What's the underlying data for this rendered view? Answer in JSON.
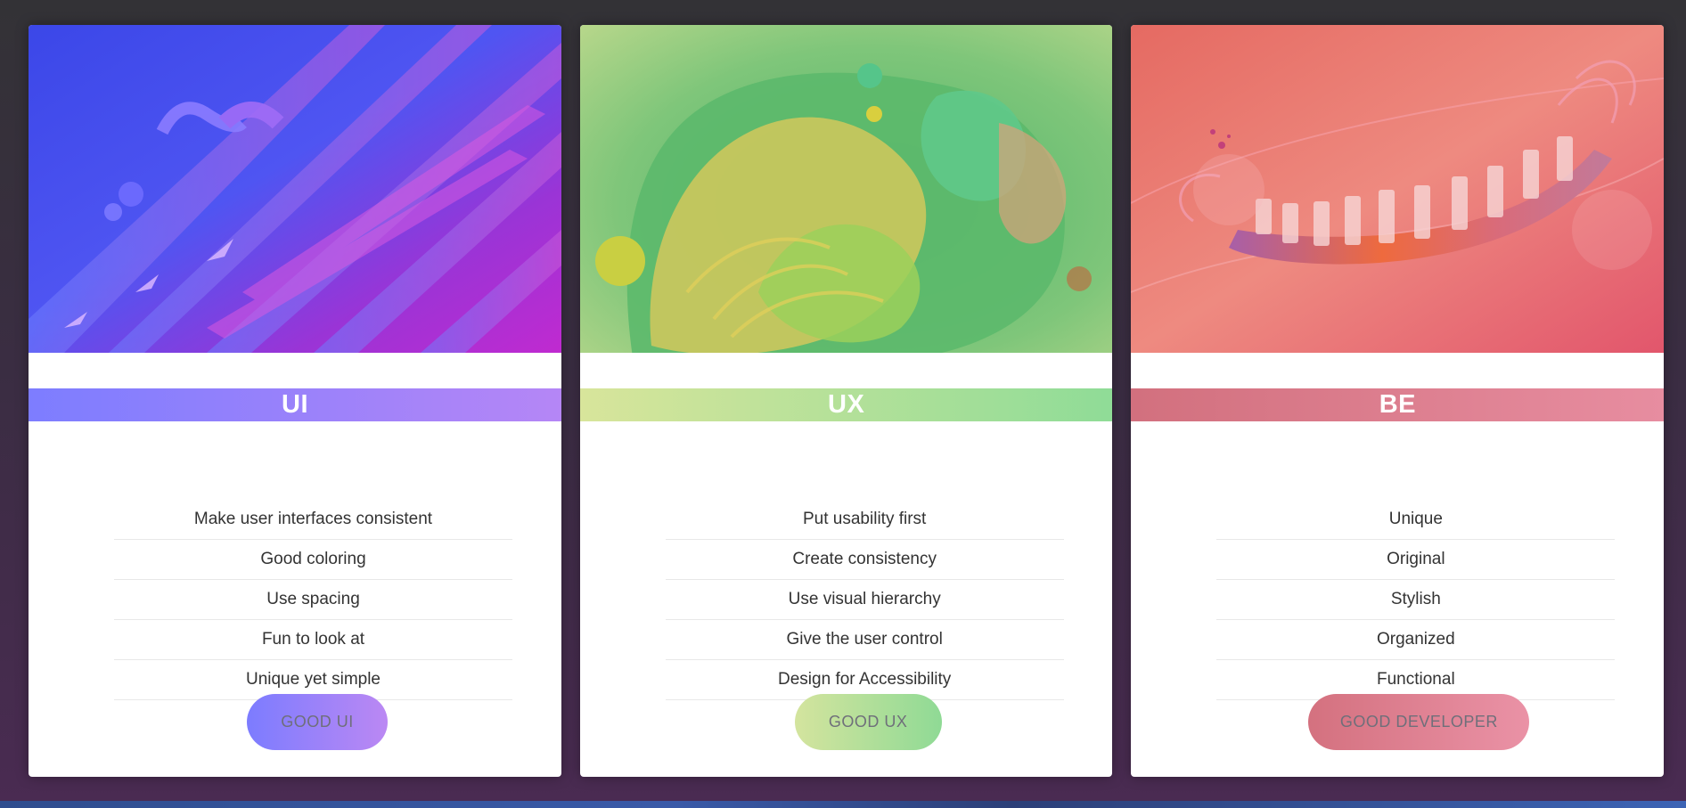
{
  "cards": [
    {
      "id": "ui",
      "title": "UI",
      "features": [
        "Make user interfaces consistent",
        "Good coloring",
        "Use spacing",
        "Fun to look at",
        "Unique yet simple"
      ],
      "button_label": "GOOD UI",
      "image_icon": "abstract-ribbons-image",
      "colors": [
        "#7d7dff",
        "#b586f6"
      ]
    },
    {
      "id": "ux",
      "title": "UX",
      "features": [
        "Put usability first",
        "Create consistency",
        "Use visual hierarchy",
        "Give the user control",
        "Design for Accessibility"
      ],
      "button_label": "GOOD UX",
      "image_icon": "fluid-swirl-image",
      "colors": [
        "#d8e59b",
        "#8fdc97"
      ]
    },
    {
      "id": "be",
      "title": "BE",
      "features": [
        "Unique",
        "Original",
        "Stylish",
        "Organized",
        "Functional"
      ],
      "button_label": "GOOD DEVELOPER",
      "image_icon": "piano-keys-image",
      "colors": [
        "#d2707e",
        "#e78da0"
      ]
    }
  ]
}
